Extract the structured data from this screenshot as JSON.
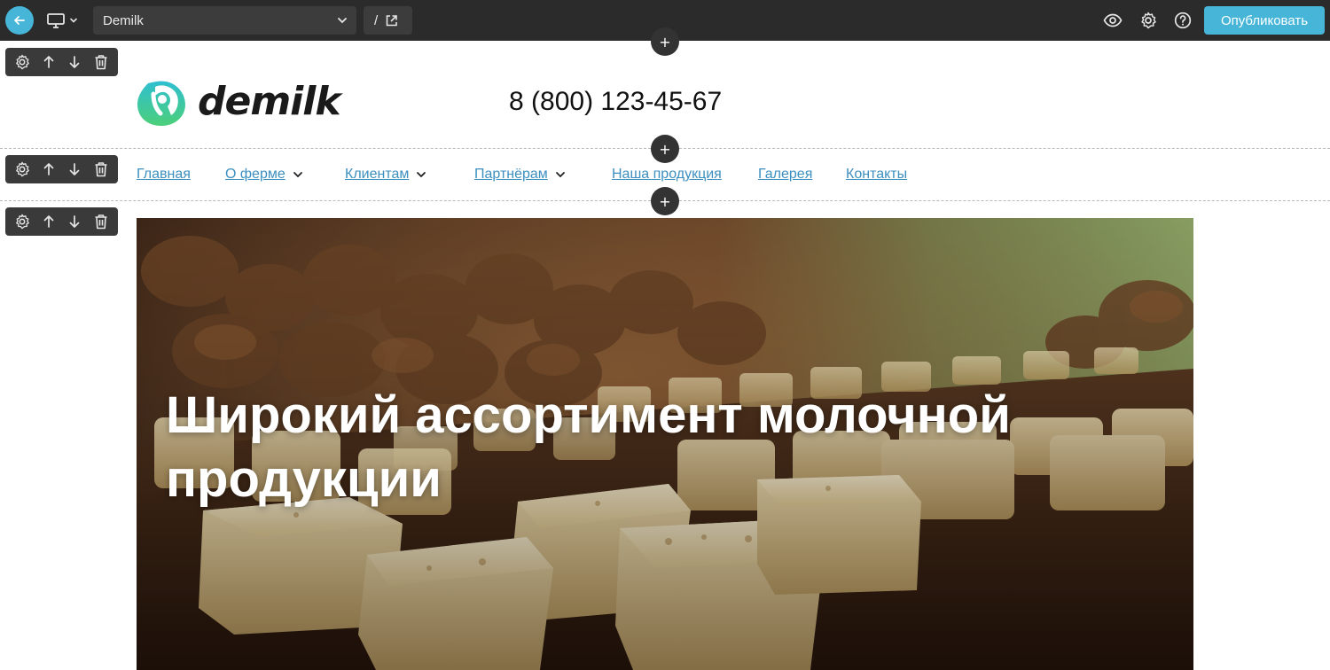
{
  "topbar": {
    "site_name": "Demilk",
    "path": "/",
    "publish_label": "Опубликовать",
    "icons": [
      "back-arrow-icon",
      "desktop-icon",
      "chevron-down-icon",
      "external-link-icon",
      "eye-icon",
      "gear-icon",
      "help-icon"
    ]
  },
  "block_tools": {
    "icons": [
      "gear-icon",
      "arrow-up-icon",
      "arrow-down-icon",
      "trash-icon"
    ]
  },
  "add_label": "+",
  "header": {
    "logo_text": "demilk",
    "phone": "8 (800) 123-45-67"
  },
  "nav": {
    "items": [
      {
        "label": "Главная",
        "dropdown": false
      },
      {
        "label": "О ферме",
        "dropdown": true
      },
      {
        "label": "Клиентам",
        "dropdown": true
      },
      {
        "label": "Партнёрам",
        "dropdown": true
      },
      {
        "label": "Наша продукция",
        "dropdown": false
      },
      {
        "label": "Галерея",
        "dropdown": false
      },
      {
        "label": "Контакты",
        "dropdown": false
      }
    ]
  },
  "hero": {
    "title_line1": "Широкий ассортимент молочной",
    "title_line2": "продукции"
  },
  "colors": {
    "accent": "#46b5d8",
    "topbar": "#2b2b2b",
    "nav_link": "#3c8fbf",
    "logo_gradient_start": "#2fbfd0",
    "logo_gradient_end": "#4ccf7a"
  }
}
